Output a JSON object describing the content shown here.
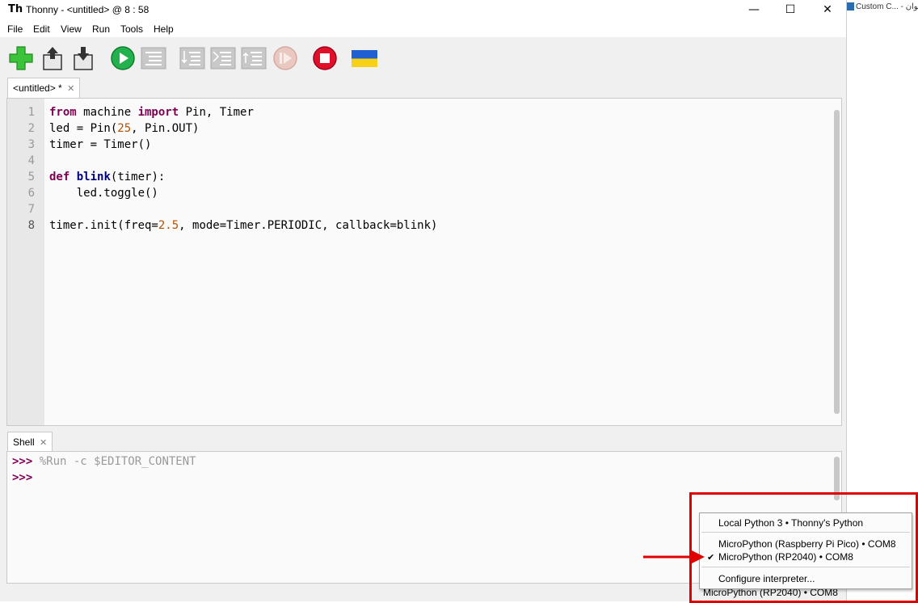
{
  "window": {
    "title": "Thonny  -  <untitled>  @  8 : 58",
    "minimize_glyph": "—",
    "maximize_glyph": "☐",
    "close_glyph": "✕"
  },
  "menu": [
    "File",
    "Edit",
    "View",
    "Run",
    "Tools",
    "Help"
  ],
  "toolbar": {
    "buttons": [
      "new-file",
      "open-file",
      "save-file",
      "run",
      "debug",
      "step-over",
      "step-into",
      "step-out",
      "resume",
      "stop",
      "support-ukraine"
    ]
  },
  "editor": {
    "tab_label": "<untitled> *",
    "tab_close": "✕",
    "line_numbers": [
      "1",
      "2",
      "3",
      "4",
      "5",
      "6",
      "7",
      "8"
    ]
  },
  "code": {
    "l1": {
      "k1": "from",
      "t1": " machine ",
      "k2": "import",
      "t2": " Pin, Timer"
    },
    "l2": {
      "t1": "led = Pin(",
      "n1": "25",
      "t2": ", Pin.OUT)"
    },
    "l3": {
      "t1": "timer = Timer()"
    },
    "l5": {
      "k1": "def",
      "sp": " ",
      "f1": "blink",
      "t1": "(timer):"
    },
    "l6": {
      "t1": "    led.toggle()"
    },
    "l8": {
      "t1": "timer.init(freq=",
      "n1": "2.5",
      "t2": ", mode=Timer.PERIODIC, callback=blink)"
    }
  },
  "shell": {
    "tab_label": "Shell",
    "tab_close": "✕",
    "prompt": ">>>",
    "command": " %Run -c $EDITOR_CONTENT"
  },
  "interpreter_menu": {
    "items": [
      "Local Python 3  •  Thonny's Python",
      "MicroPython (Raspberry Pi Pico)  •  COM8",
      "MicroPython (RP2040)  •  COM8",
      "Configure interpreter..."
    ],
    "checked_item": "MicroPython (RP2040)  •  COM8",
    "check_glyph": "✔"
  },
  "statusbar": {
    "interpreter": "MicroPython (RP2040)  •  COM8"
  },
  "side_window": {
    "title": "Custom C... - حوان"
  },
  "colors": {
    "annotation_red": "#e00000",
    "keyword": "#7f0055",
    "function_name": "#000080",
    "number": "#b45000"
  }
}
